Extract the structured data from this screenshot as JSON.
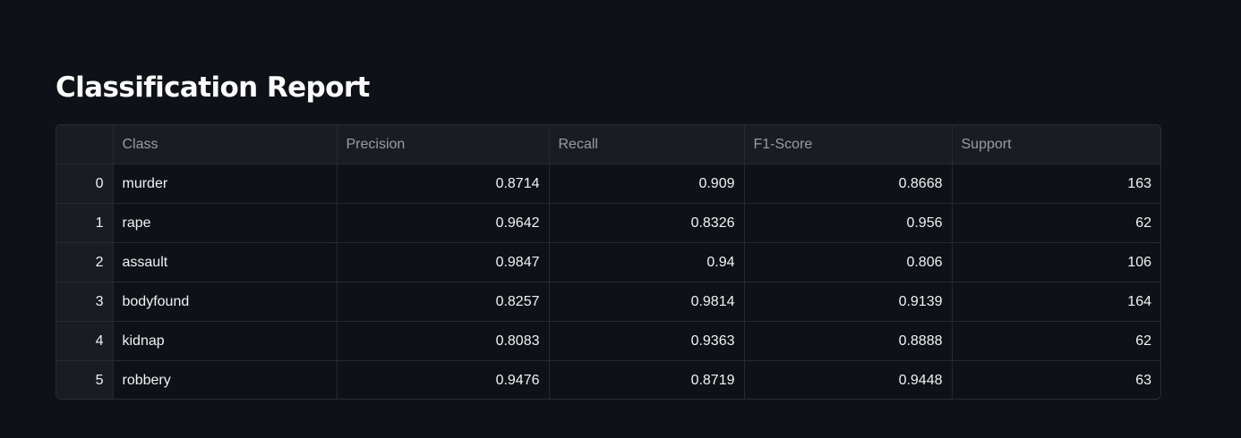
{
  "title": "Classification Report",
  "table": {
    "columns": [
      "",
      "Class",
      "Precision",
      "Recall",
      "F1-Score",
      "Support"
    ],
    "rows": [
      {
        "index": "0",
        "class": "murder",
        "precision": "0.8714",
        "recall": "0.909",
        "f1": "0.8668",
        "support": "163"
      },
      {
        "index": "1",
        "class": "rape",
        "precision": "0.9642",
        "recall": "0.8326",
        "f1": "0.956",
        "support": "62"
      },
      {
        "index": "2",
        "class": "assault",
        "precision": "0.9847",
        "recall": "0.94",
        "f1": "0.806",
        "support": "106"
      },
      {
        "index": "3",
        "class": "bodyfound",
        "precision": "0.8257",
        "recall": "0.9814",
        "f1": "0.9139",
        "support": "164"
      },
      {
        "index": "4",
        "class": "kidnap",
        "precision": "0.8083",
        "recall": "0.9363",
        "f1": "0.8888",
        "support": "62"
      },
      {
        "index": "5",
        "class": "robbery",
        "precision": "0.9476",
        "recall": "0.8719",
        "f1": "0.9448",
        "support": "63"
      }
    ]
  }
}
